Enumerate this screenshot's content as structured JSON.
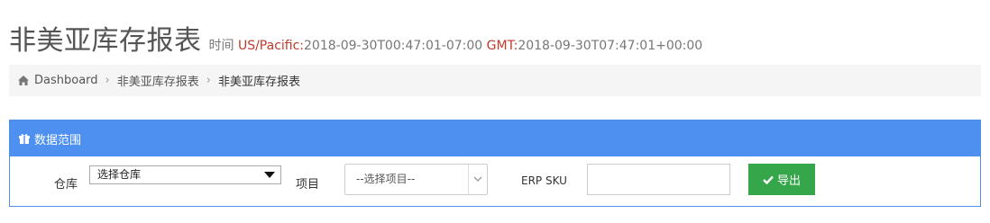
{
  "header": {
    "title": "非美亚库存报表",
    "time_label": "时间",
    "tz_name": "US/Pacific:",
    "tz_time": "2018-09-30T00:47:01-07:00",
    "gmt_label": "GMT:",
    "gmt_time": "2018-09-30T07:47:01+00:00"
  },
  "breadcrumb": {
    "items": [
      "Dashboard",
      "非美亚库存报表",
      "非美亚库存报表"
    ]
  },
  "panel": {
    "title": "数据范围",
    "warehouse_label": "仓库",
    "warehouse_value": "选择仓库",
    "project_label": "项目",
    "project_value": "--选择项目--",
    "sku_label": "ERP SKU",
    "sku_value": "",
    "export_label": "导出"
  },
  "colors": {
    "panel_header": "#4d90f0",
    "export_button": "#35a74a",
    "tz_highlight": "#c0392b"
  }
}
